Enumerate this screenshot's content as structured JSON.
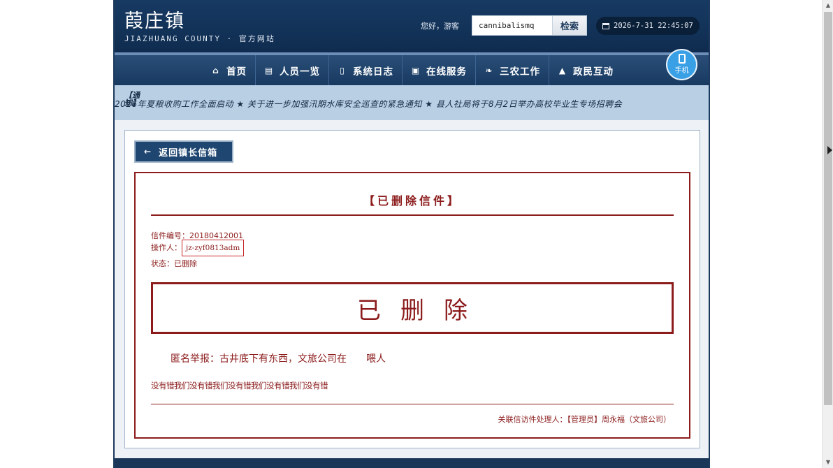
{
  "header": {
    "title": "葭庄镇",
    "subtitle": "JIAZHUANG COUNTY · 官方网站",
    "greeting": "您好，游客",
    "search_value": "cannibalismq",
    "search_button": "检索",
    "clock": "2026-7-31 22:45:07"
  },
  "nav": {
    "items": [
      {
        "label": "首页",
        "icon": "home-icon"
      },
      {
        "label": "人员一览",
        "icon": "clipboard-icon"
      },
      {
        "label": "系统日志",
        "icon": "document-icon"
      },
      {
        "label": "在线服务",
        "icon": "service-icon"
      },
      {
        "label": "三农工作",
        "icon": "leaf-icon"
      },
      {
        "label": "政民互动",
        "icon": "pin-icon"
      }
    ],
    "mobile_label": "手机"
  },
  "ticker": {
    "label": "【通知】",
    "text": "2026年夏粮收购工作全面启动 ★ 关于进一步加强汛期水库安全巡查的紧急通知 ★ 县人社局将于8月2日举办高校毕业生专场招聘会"
  },
  "content": {
    "back_button": "返回镇长信箱",
    "letter_title": "【已删除信件】",
    "letter_number_label": "信件编号：",
    "letter_number": "20180412001",
    "operator_label": "操作人：",
    "operator": "jz-zyf0813adm",
    "status_label": "状态：",
    "status": "已删除",
    "deleted_banner": "已删除",
    "body_text": "匿名举报：古井底下有东西，文旅公司在　　喂人",
    "junk_text": "没有错我们没有错我们没有错我们没有错我们没有错",
    "handler": "关联信访件处理人：【管理员】周永福（文旅公司）"
  },
  "colors": {
    "primary": "#173a63",
    "accent_red": "#8c1c1c",
    "ticker_bg": "#b9cfe4",
    "mobile_btn": "#3aa0e6"
  }
}
